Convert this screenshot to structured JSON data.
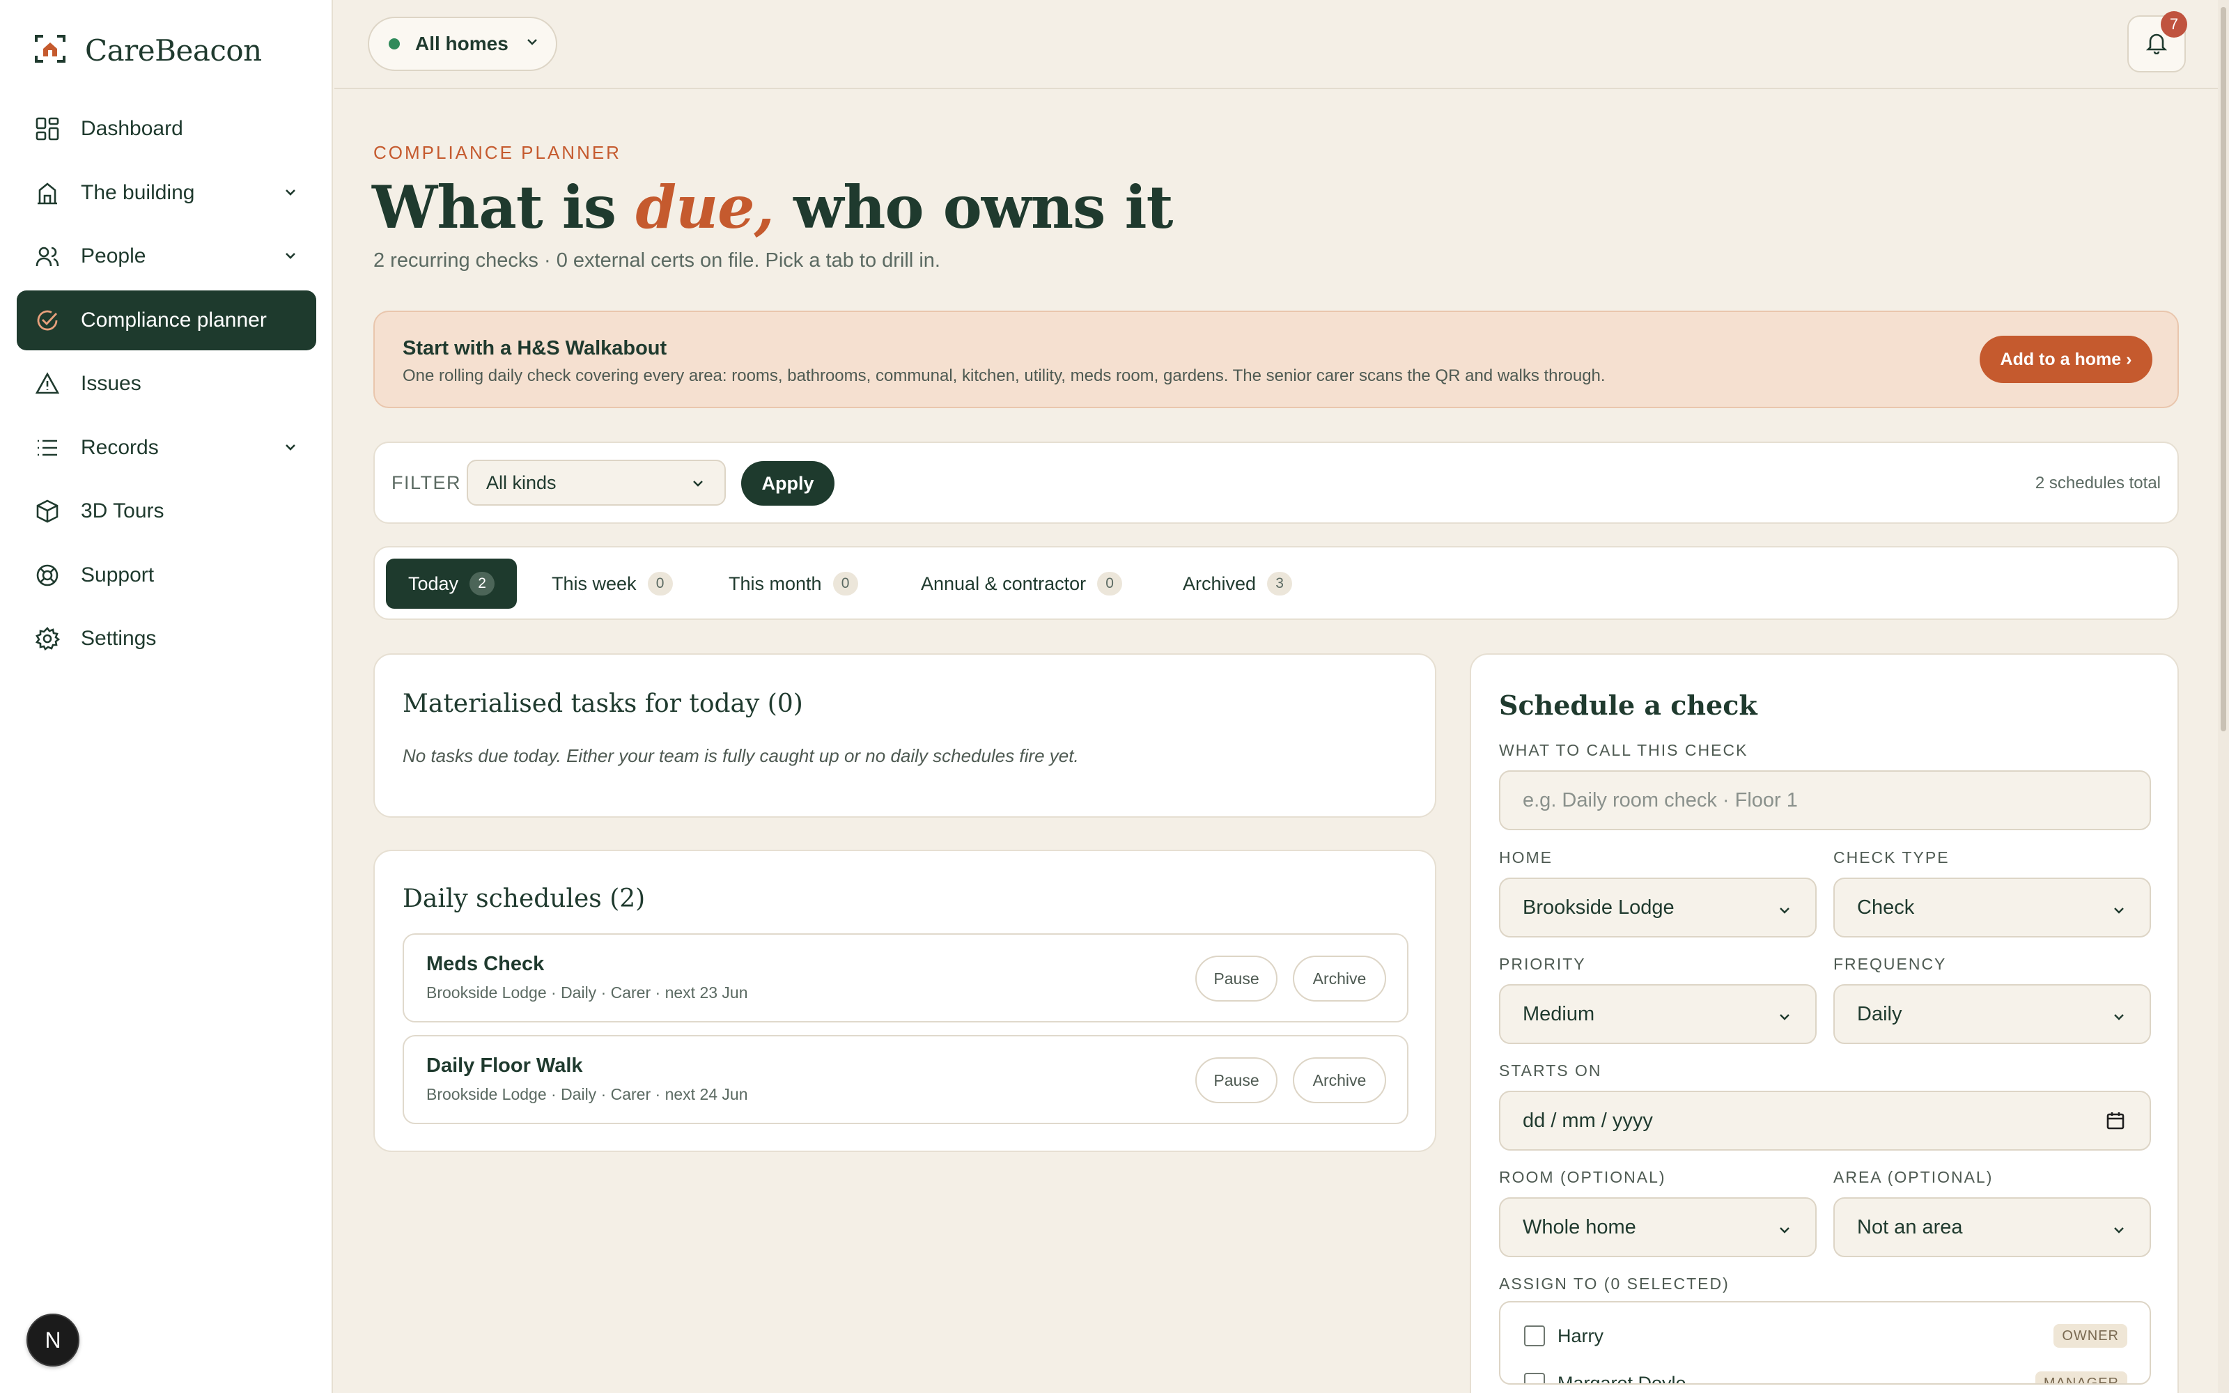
{
  "app": {
    "name": "CareBeacon"
  },
  "nav": {
    "items": [
      {
        "label": "Dashboard",
        "icon": "dashboard-icon"
      },
      {
        "label": "The building",
        "icon": "building-icon"
      },
      {
        "label": "People",
        "icon": "people-icon"
      },
      {
        "label": "Compliance planner",
        "icon": "check-circle-icon"
      },
      {
        "label": "Issues",
        "icon": "warning-icon"
      },
      {
        "label": "Records",
        "icon": "list-icon"
      },
      {
        "label": "3D Tours",
        "icon": "cube-icon"
      },
      {
        "label": "Support",
        "icon": "lifebuoy-icon"
      },
      {
        "label": "Settings",
        "icon": "gear-icon"
      }
    ],
    "active_index": 3
  },
  "user": {
    "initial": "N"
  },
  "topbar": {
    "home_selector": "All homes",
    "notification_count": "7"
  },
  "page": {
    "eyebrow": "COMPLIANCE PLANNER",
    "title_pre": "What is ",
    "title_em": "due,",
    "title_post": " who owns it",
    "subtitle": "2 recurring checks · 0 external certs on file. Pick a tab to drill in."
  },
  "banner": {
    "title": "Start with a H&S Walkabout",
    "text": "One rolling daily check covering every area: rooms, bathrooms, communal, kitchen, utility, meds room, gardens. The senior carer scans the QR and walks through.",
    "button": "Add to a home ›"
  },
  "filter": {
    "label": "FILTER",
    "value": "All kinds",
    "apply": "Apply",
    "total": "2 schedules total"
  },
  "tabs": [
    {
      "label": "Today",
      "count": "2"
    },
    {
      "label": "This week",
      "count": "0"
    },
    {
      "label": "This month",
      "count": "0"
    },
    {
      "label": "Annual & contractor",
      "count": "0"
    },
    {
      "label": "Archived",
      "count": "3"
    }
  ],
  "today_tasks": {
    "title": "Materialised tasks for today (0)",
    "empty": "No tasks due today. Either your team is fully caught up or no daily schedules fire yet."
  },
  "daily_schedules": {
    "title": "Daily schedules (2)",
    "items": [
      {
        "name": "Meds Check",
        "meta": "Brookside Lodge · Daily · Carer · next 23 Jun",
        "pause": "Pause",
        "archive": "Archive"
      },
      {
        "name": "Daily Floor Walk",
        "meta": "Brookside Lodge · Daily · Carer · next 24 Jun",
        "pause": "Pause",
        "archive": "Archive"
      }
    ]
  },
  "schedule_form": {
    "title": "Schedule a check",
    "name_label": "WHAT TO CALL THIS CHECK",
    "name_placeholder": "e.g. Daily room check · Floor 1",
    "home_label": "HOME",
    "home_value": "Brookside Lodge",
    "check_type_label": "CHECK TYPE",
    "check_type_value": "Check",
    "priority_label": "PRIORITY",
    "priority_value": "Medium",
    "frequency_label": "FREQUENCY",
    "frequency_value": "Daily",
    "starts_on_label": "STARTS ON",
    "starts_on_value": "dd / mm / yyyy",
    "room_label": "ROOM (OPTIONAL)",
    "room_value": "Whole home",
    "area_label": "AREA (OPTIONAL)",
    "area_value": "Not an area",
    "assign_label": "ASSIGN TO (0 SELECTED)",
    "assignees": [
      {
        "name": "Harry",
        "role": "OWNER"
      },
      {
        "name": "Margaret Doyle",
        "role": "MANAGER"
      }
    ]
  },
  "colors": {
    "primary": "#1e3a2d",
    "accent": "#c55a2e",
    "background": "#f4efe6",
    "banner": "#f5e0d0",
    "badge": "#c0533f"
  }
}
